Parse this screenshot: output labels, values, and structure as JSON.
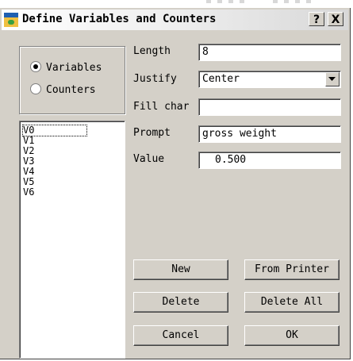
{
  "window": {
    "title": "Define Variables and Counters",
    "help_label": "?",
    "close_label": "X",
    "icon": "app-icon"
  },
  "mode": {
    "options": [
      "Variables",
      "Counters"
    ],
    "selected": "Variables"
  },
  "list": {
    "items": [
      "V0",
      "V1",
      "V2",
      "V3",
      "V4",
      "V5",
      "V6"
    ],
    "selected_index": 0
  },
  "form": {
    "length_label": "Length",
    "length_value": "8",
    "justify_label": "Justify",
    "justify_value": "Center",
    "fill_label": "Fill char",
    "fill_value": "",
    "prompt_label": "Prompt",
    "prompt_value": "gross weight",
    "value_label": "Value",
    "value_value": "0.500"
  },
  "buttons": {
    "new": "New",
    "from_printer": "From Printer",
    "delete": "Delete",
    "delete_all": "Delete All",
    "cancel": "Cancel",
    "ok": "OK"
  },
  "colors": {
    "face": "#d4d0c8",
    "shadow": "#808080",
    "highlight": "#ffffff",
    "selection": "#0a246a"
  }
}
